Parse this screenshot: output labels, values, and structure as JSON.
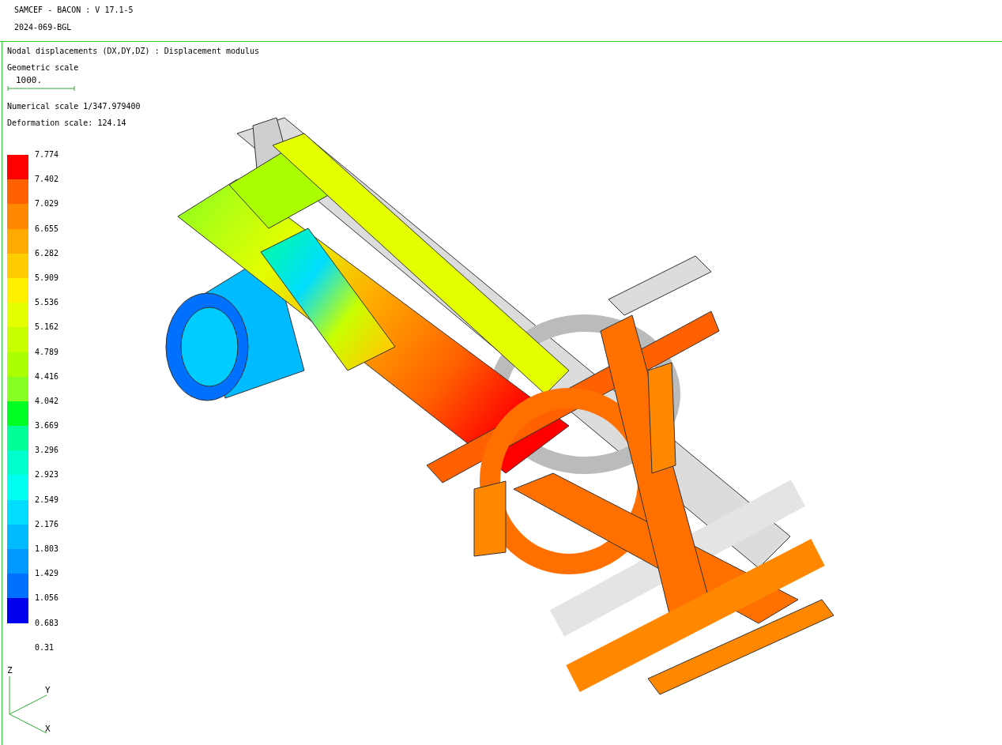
{
  "header": {
    "title": "SAMCEF - BACON : V 17.1-5",
    "subtitle": "2024-069-BGL"
  },
  "info": {
    "result": "Nodal displacements (DX,DY,DZ) : Displacement modulus",
    "geometric_scale_label": "Geometric scale",
    "geometric_scale_value": "1000.",
    "numerical_scale": "Numerical scale 1/347.979400",
    "deformation_scale": "Deformation scale: 124.14"
  },
  "legend": {
    "labels": [
      "7.774",
      "7.402",
      "7.029",
      "6.655",
      "6.282",
      "5.909",
      "5.536",
      "5.162",
      "4.789",
      "4.416",
      "4.042",
      "3.669",
      "3.296",
      "2.923",
      "2.549",
      "2.176",
      "1.803",
      "1.429",
      "1.056",
      "0.683",
      "0.31"
    ],
    "bands": [
      {
        "color": "#ff0000"
      },
      {
        "color": "#ff6000"
      },
      {
        "color": "#ff8800"
      },
      {
        "color": "#ffaa00"
      },
      {
        "color": "#ffcc00"
      },
      {
        "color": "#fff000"
      },
      {
        "color": "#e4ff00"
      },
      {
        "color": "#c8ff00"
      },
      {
        "color": "#aaff00"
      },
      {
        "color": "#88ff22"
      },
      {
        "color": "#00ff22"
      },
      {
        "color": "#00ff99"
      },
      {
        "color": "#00ffcc"
      },
      {
        "color": "#00ffee"
      },
      {
        "color": "#00ddff"
      },
      {
        "color": "#00bbff"
      },
      {
        "color": "#0099ff"
      },
      {
        "color": "#0070ff"
      },
      {
        "color": "#0000ee"
      }
    ]
  },
  "axes": {
    "z": "Z",
    "y": "Y",
    "x": "X"
  }
}
